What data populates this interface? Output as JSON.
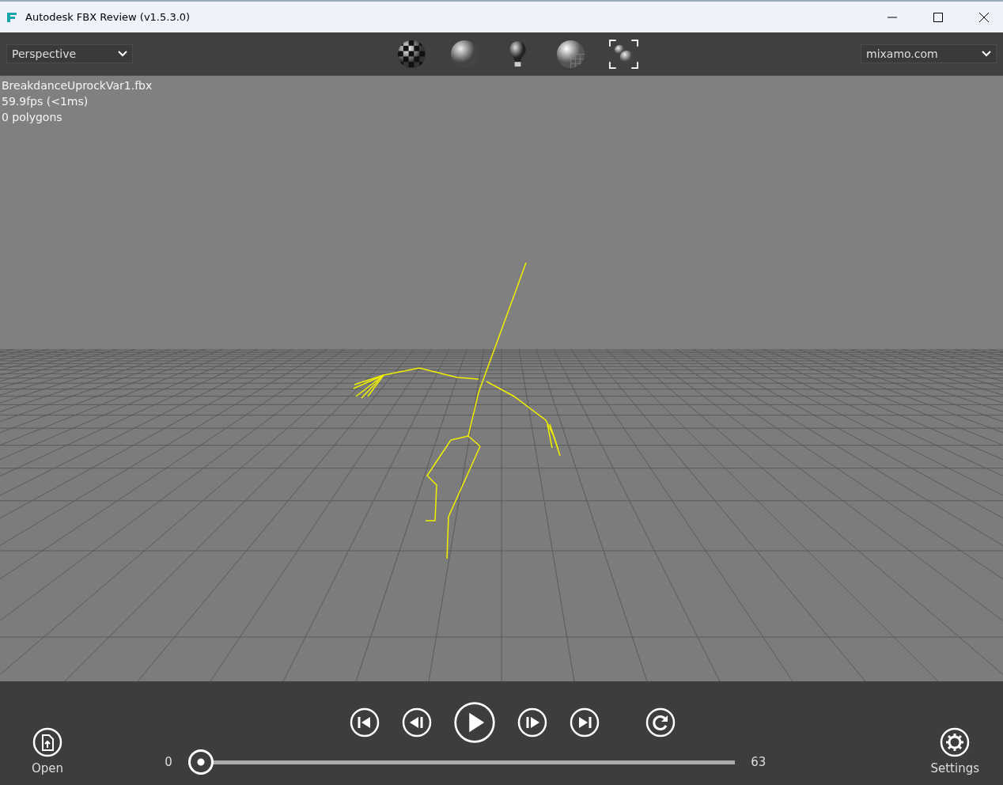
{
  "window": {
    "title": "Autodesk FBX Review (v1.5.3.0)"
  },
  "toolbar": {
    "camera": "Perspective",
    "take": "mixamo.com"
  },
  "overlay": [
    "BreakdanceUprockVar1.fbx",
    "59.9fps (<1ms)",
    "0 polygons"
  ],
  "bottom": {
    "open": "Open",
    "settings": "Settings",
    "start_frame": "0",
    "end_frame": "63",
    "timeline": {
      "level": 0
    }
  }
}
